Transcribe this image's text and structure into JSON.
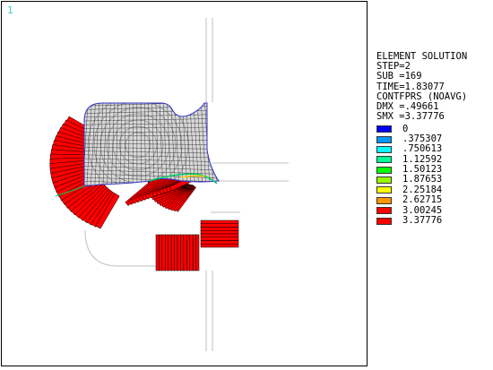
{
  "window": {
    "number": "1"
  },
  "legend": {
    "lines": [
      "ELEMENT SOLUTION",
      "STEP=2",
      "SUB =169",
      "TIME=1.83077",
      "CONTFPRS (NOAVG)",
      "DMX =.49661",
      "SMX =3.37776"
    ],
    "scale": [
      {
        "label": "0",
        "color": "#0000ff"
      },
      {
        "label": ".375307",
        "color": "#0095ff"
      },
      {
        "label": ".750613",
        "color": "#00ffff"
      },
      {
        "label": "1.12592",
        "color": "#00ff95"
      },
      {
        "label": "1.50123",
        "color": "#00ff00"
      },
      {
        "label": "1.87653",
        "color": "#95ff00"
      },
      {
        "label": "2.25184",
        "color": "#ffff00"
      },
      {
        "label": "2.62715",
        "color": "#ff9500"
      },
      {
        "label": "3.00245",
        "color": "#ff0000"
      },
      {
        "label": "3.37776",
        "color": "#ff0000"
      }
    ]
  },
  "colors": {
    "mesh_line": "#333333",
    "mesh_fill": "#d9d9d9",
    "boundary": "#3333cc",
    "pressure": "#ff0000",
    "guide": "#bfbfbf"
  }
}
